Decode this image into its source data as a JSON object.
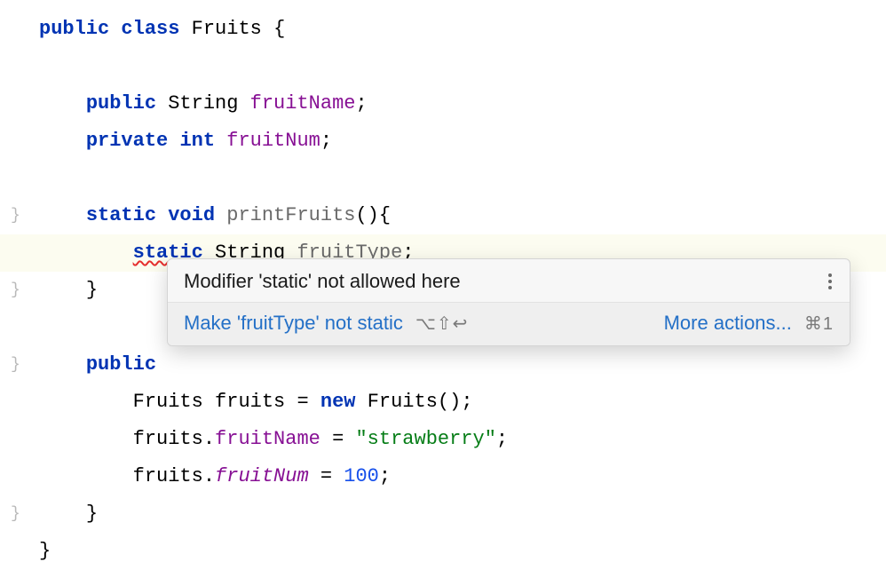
{
  "code": {
    "kw_public": "public",
    "kw_class": "class",
    "kw_private": "private",
    "kw_static": "static",
    "kw_void": "void",
    "kw_new": "new",
    "type_String": "String",
    "type_int": "int",
    "cls_Fruits": "Fruits",
    "field_fruitName": "fruitName",
    "field_fruitNum": "fruitNum",
    "method_printFruits": "printFruits",
    "var_fruitType": "fruitType",
    "var_fruits": "fruits",
    "str_strawberry": "\"strawberry\"",
    "num_100": "100",
    "parens": "()",
    "brace_open": "{",
    "brace_close": "}",
    "semi": ";",
    "eq": "=",
    "dot": "."
  },
  "tooltip": {
    "message": "Modifier 'static' not allowed here",
    "fix_action": "Make 'fruitType' not static",
    "fix_shortcut": "⌥⇧↩",
    "more_actions": "More actions...",
    "more_shortcut": "⌘1"
  }
}
